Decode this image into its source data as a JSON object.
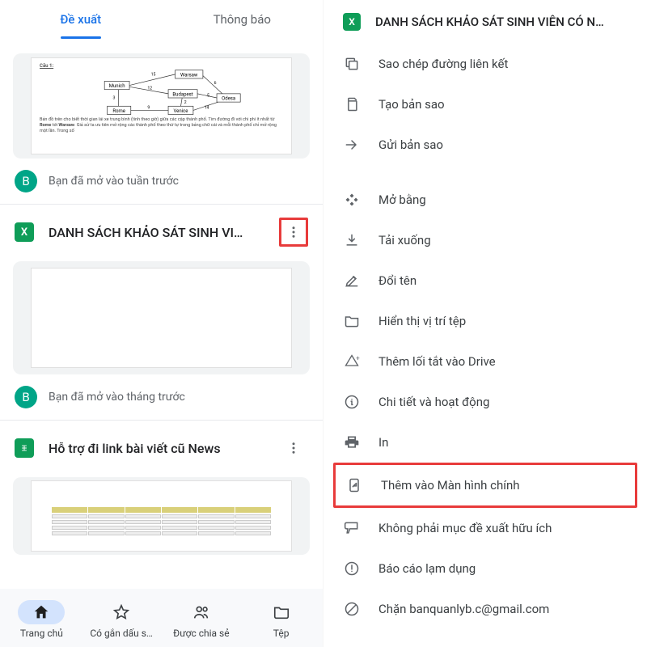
{
  "tabs": {
    "suggested": "Đề xuất",
    "notifications": "Thông báo"
  },
  "files": [
    {
      "meta": "Bạn đã mở vào tuần trước",
      "avatar_letter": "B"
    },
    {
      "title": "DANH SÁCH KHẢO SÁT SINH VI…",
      "meta": "Bạn đã mở vào tháng trước",
      "avatar_letter": "B"
    },
    {
      "title": "Hỗ trợ đi link bài viết cũ News"
    }
  ],
  "bottom_nav": {
    "home": "Trang chủ",
    "starred": "Có gắn dấu s…",
    "shared": "Được chia sẻ",
    "files": "Tệp"
  },
  "panel": {
    "title": "DANH SÁCH KHẢO SÁT SINH VIÊN CÓ N…",
    "items": {
      "copy_link": "Sao chép đường liên kết",
      "make_copy": "Tạo bản sao",
      "send_copy": "Gửi bản sao",
      "open_with": "Mở bằng",
      "download": "Tải xuống",
      "rename": "Đổi tên",
      "show_location": "Hiển thị vị trí tệp",
      "add_shortcut": "Thêm lối tắt vào Drive",
      "details": "Chi tiết và hoạt động",
      "print": "In",
      "add_home": "Thêm vào Màn hình chính",
      "not_helpful": "Không phải mục đề xuất hữu ích",
      "report": "Báo cáo lạm dụng",
      "block": "Chặn banquanlyb.c@gmail.com"
    }
  },
  "file_icon_letter": "X"
}
